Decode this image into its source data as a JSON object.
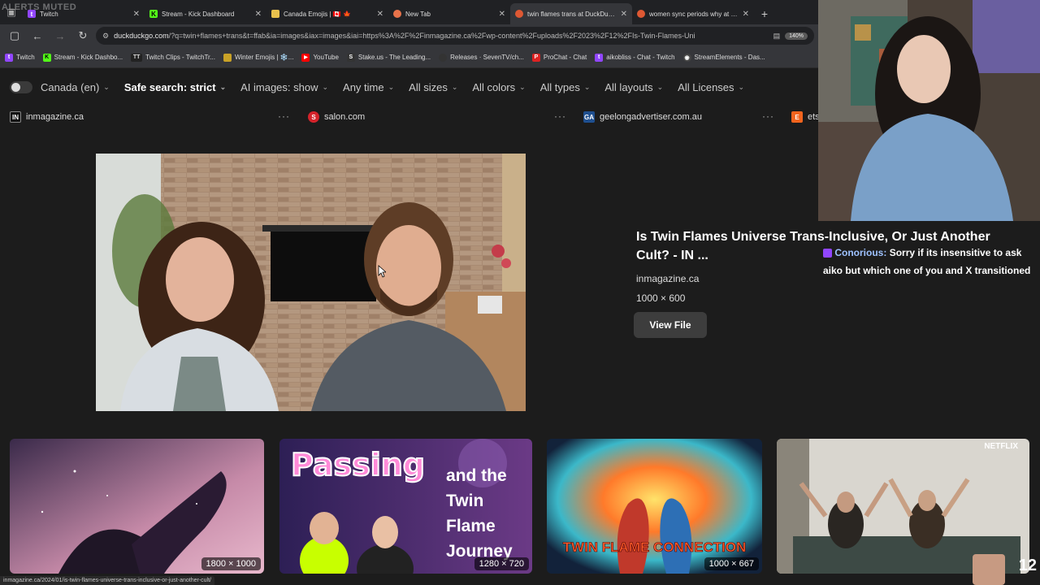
{
  "overlay": {
    "alerts_label": "ALERTS MUTED"
  },
  "tabs": [
    {
      "label": "Twitch",
      "fav_color": "#9146ff"
    },
    {
      "label": "Stream - Kick Dashboard",
      "fav_color": "#53fc18"
    },
    {
      "label": "Canada Emojis | 🇨🇦 🍁",
      "fav_color": "#e8c14d"
    },
    {
      "label": "New Tab",
      "fav_color": "#e8734a"
    },
    {
      "label": "twin flames trans at DuckDuckGo",
      "fav_color": "#de5833",
      "active": true
    },
    {
      "label": "women sync periods why at Du",
      "fav_color": "#de5833"
    }
  ],
  "address": {
    "url_host": "duckduckgo.com",
    "url_rest": "/?q=twin+flames+trans&t=ffab&ia=images&iax=images&iai=https%3A%2F%2Finmagazine.ca%2Fwp-content%2Fuploads%2F2023%2F12%2FIs-Twin-Flames-Uni",
    "zoom": "140%"
  },
  "bookmarks": [
    {
      "label": "Twitch",
      "color": "#9146ff",
      "glyph": "t"
    },
    {
      "label": "Stream - Kick Dashbo...",
      "color": "#53fc18",
      "glyph": "K"
    },
    {
      "label": "Twitch Clips - TwitchTr...",
      "color": "#222",
      "glyph": "TT"
    },
    {
      "label": "Winter Emojis | ❄️...",
      "color": "#c9a227",
      "glyph": "■"
    },
    {
      "label": "YouTube",
      "color": "#ff0000",
      "glyph": "▶"
    },
    {
      "label": "Stake.us - The Leading...",
      "color": "#333",
      "glyph": "S"
    },
    {
      "label": "Releases · SevenTV/ch...",
      "color": "#333",
      "glyph": ""
    },
    {
      "label": "ProChat - Chat",
      "color": "#d22",
      "glyph": "P"
    },
    {
      "label": "aikobliss - Chat - Twitch",
      "color": "#9146ff",
      "glyph": "t"
    },
    {
      "label": "StreamElements - Das...",
      "color": "#444",
      "glyph": "◉"
    }
  ],
  "filters": {
    "region": "Canada (en)",
    "safe_search": "Safe search: strict",
    "ai_images": "AI images: show",
    "time": "Any time",
    "sizes": "All sizes",
    "colors": "All colors",
    "types": "All types",
    "layouts": "All layouts",
    "licenses": "All Licenses"
  },
  "sources": [
    {
      "label": "inmagazine.ca",
      "badge": "IN",
      "color": "#111"
    },
    {
      "label": "salon.com",
      "badge": "S",
      "color": "#d4232b"
    },
    {
      "label": "geelongadvertiser.com.au",
      "badge": "GA",
      "color": "#1f4f8f"
    },
    {
      "label": "ets",
      "badge": "E",
      "color": "#f1641e"
    }
  ],
  "details": {
    "title": "Is Twin Flames Universe Trans-Inclusive, Or Just Another Cult? - IN ...",
    "site": "inmagazine.ca",
    "dims": "1000 × 600",
    "view_label": "View File"
  },
  "thumbnails": [
    {
      "dims": "1800 × 1000"
    },
    {
      "dims": "1280 × 720",
      "text_big": "Passing",
      "text_rest": "and the Twin Flame Journey"
    },
    {
      "dims": "1000 × 667",
      "caption": "TWIN FLAME CONNECTION"
    },
    {
      "dims": "",
      "brand": "NETFLIX"
    }
  ],
  "status_url": "inmagazine.ca/2024/01/is-twin-flames-universe-trans-inclusive-or-just-another-cult/",
  "chat": {
    "user": "Conorious:",
    "message": "Sorry if its insensitive to ask aiko but which one of you and X transitioned"
  },
  "corner_number": "12"
}
